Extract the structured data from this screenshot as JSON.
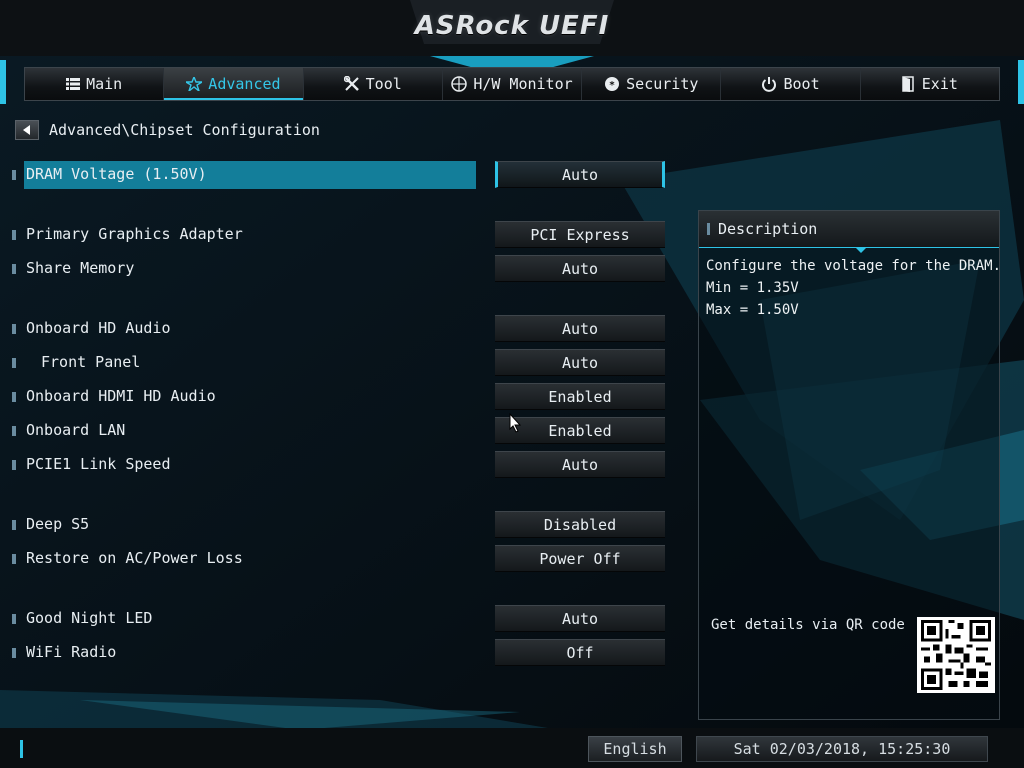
{
  "app_title": "ASRock UEFI",
  "nav": {
    "tabs": [
      {
        "label": "Main",
        "icon": "list-icon",
        "active": false
      },
      {
        "label": "Advanced",
        "icon": "star-icon",
        "active": true
      },
      {
        "label": "Tool",
        "icon": "tools-icon",
        "active": false
      },
      {
        "label": "H/W Monitor",
        "icon": "monitor-icon",
        "active": false
      },
      {
        "label": "Security",
        "icon": "shield-icon",
        "active": false
      },
      {
        "label": "Boot",
        "icon": "power-icon",
        "active": false
      },
      {
        "label": "Exit",
        "icon": "exit-icon",
        "active": false
      }
    ]
  },
  "breadcrumb": "Advanced\\Chipset Configuration",
  "settings": [
    {
      "label": "DRAM Voltage (1.50V)",
      "value": "Auto",
      "selected": true
    },
    {
      "label": "Primary Graphics Adapter",
      "value": "PCI Express"
    },
    {
      "label": "Share Memory",
      "value": "Auto"
    },
    {
      "label": "Onboard HD Audio",
      "value": "Auto"
    },
    {
      "label": "Front Panel",
      "value": "Auto",
      "indent": true
    },
    {
      "label": "Onboard HDMI HD Audio",
      "value": "Enabled"
    },
    {
      "label": "Onboard LAN",
      "value": "Enabled"
    },
    {
      "label": "PCIE1 Link Speed",
      "value": "Auto"
    },
    {
      "label": "Deep S5",
      "value": "Disabled"
    },
    {
      "label": "Restore on AC/Power Loss",
      "value": "Power Off"
    },
    {
      "label": "Good Night LED",
      "value": "Auto"
    },
    {
      "label": "WiFi Radio",
      "value": "Off"
    }
  ],
  "description": {
    "title": "Description",
    "lines": [
      "Configure the voltage for the DRAM.",
      "Min = 1.35V",
      "Max = 1.50V"
    ],
    "qr_text": "Get details via QR code"
  },
  "footer": {
    "language": "English",
    "datetime": "Sat 02/03/2018, 15:25:30"
  },
  "colors": {
    "accent": "#2ec3e6",
    "selection": "#137e9a",
    "background": "#061018"
  }
}
